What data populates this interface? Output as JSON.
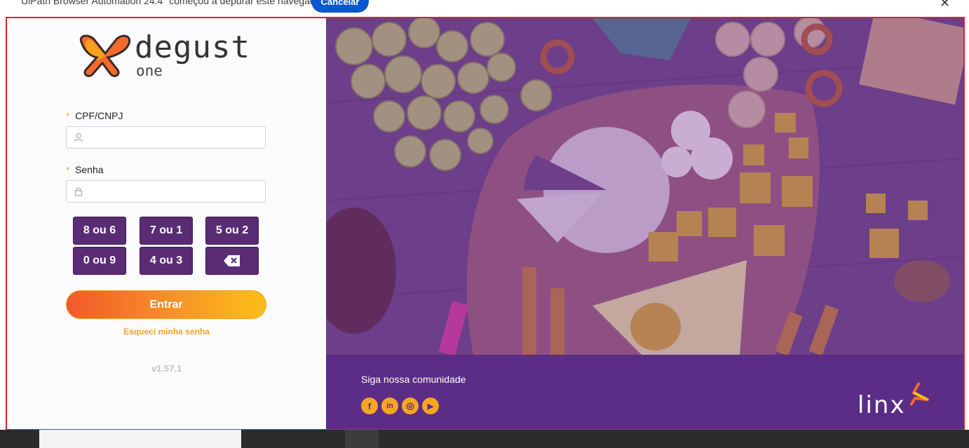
{
  "notification": {
    "message": "UiPath Browser Automation 24.4\" começou a depurar este navegador",
    "cancel_label": "Cancelar",
    "close_symbol": "✕"
  },
  "login": {
    "brand": "degust",
    "brand_sub": "one",
    "cpf_label": "CPF/CNPJ",
    "cpf_value": "",
    "password_label": "Senha",
    "password_value": "",
    "required_mark": "*",
    "keypad": [
      "8 ou 6",
      "7 ou 1",
      "5 ou 2",
      "0 ou 9",
      "4 ou 3"
    ],
    "backspace_icon": "backspace-icon",
    "submit_label": "Entrar",
    "forgot_label": "Esqueci minha senha",
    "version": "v1.57.1"
  },
  "footer": {
    "follow_label": "Siga nossa comunidade",
    "social": [
      {
        "name": "facebook",
        "glyph": "f"
      },
      {
        "name": "linkedin",
        "glyph": "in"
      },
      {
        "name": "instagram",
        "glyph": "◎"
      },
      {
        "name": "youtube",
        "glyph": "▶"
      }
    ],
    "partner_logo": "linx"
  },
  "colors": {
    "keypad": "#5a2c74",
    "accent_orange": "#f79326",
    "footer_purple": "#5b2d86",
    "frame_border": "#d8232a"
  }
}
